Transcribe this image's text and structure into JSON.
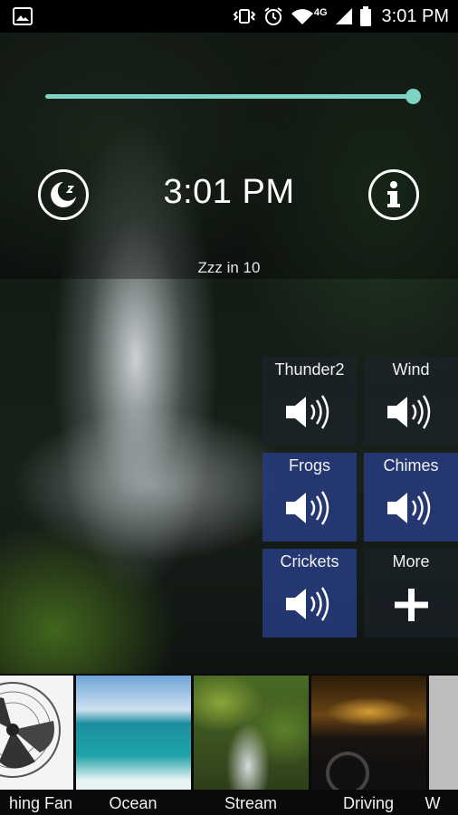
{
  "status_bar": {
    "time": "3:01 PM",
    "network": "4G",
    "icons": [
      "image-icon",
      "vibrate-icon",
      "alarm-icon",
      "wifi-icon",
      "signal-icon",
      "battery-icon"
    ]
  },
  "volume": {
    "level": 1.0,
    "color": "#7fd3c4"
  },
  "header": {
    "sleep_icon": "moon-timer-icon",
    "clock": "3:01 PM",
    "info_icon": "info-icon",
    "sleep_status": "Zzz in 10"
  },
  "sounds": [
    {
      "label": "Thunder2",
      "active": false,
      "icon": "speaker-icon"
    },
    {
      "label": "Wind",
      "active": false,
      "icon": "speaker-icon"
    },
    {
      "label": "Frogs",
      "active": true,
      "icon": "speaker-icon"
    },
    {
      "label": "Chimes",
      "active": true,
      "icon": "speaker-icon"
    },
    {
      "label": "Crickets",
      "active": true,
      "icon": "speaker-icon"
    },
    {
      "label": "More",
      "active": false,
      "icon": "plus-icon"
    }
  ],
  "scenes": [
    {
      "label": "hing Fan"
    },
    {
      "label": "Ocean"
    },
    {
      "label": "Stream"
    },
    {
      "label": "Driving"
    },
    {
      "label": "W"
    }
  ],
  "colors": {
    "active_tile": "#263a78",
    "accent": "#7fd3c4"
  }
}
